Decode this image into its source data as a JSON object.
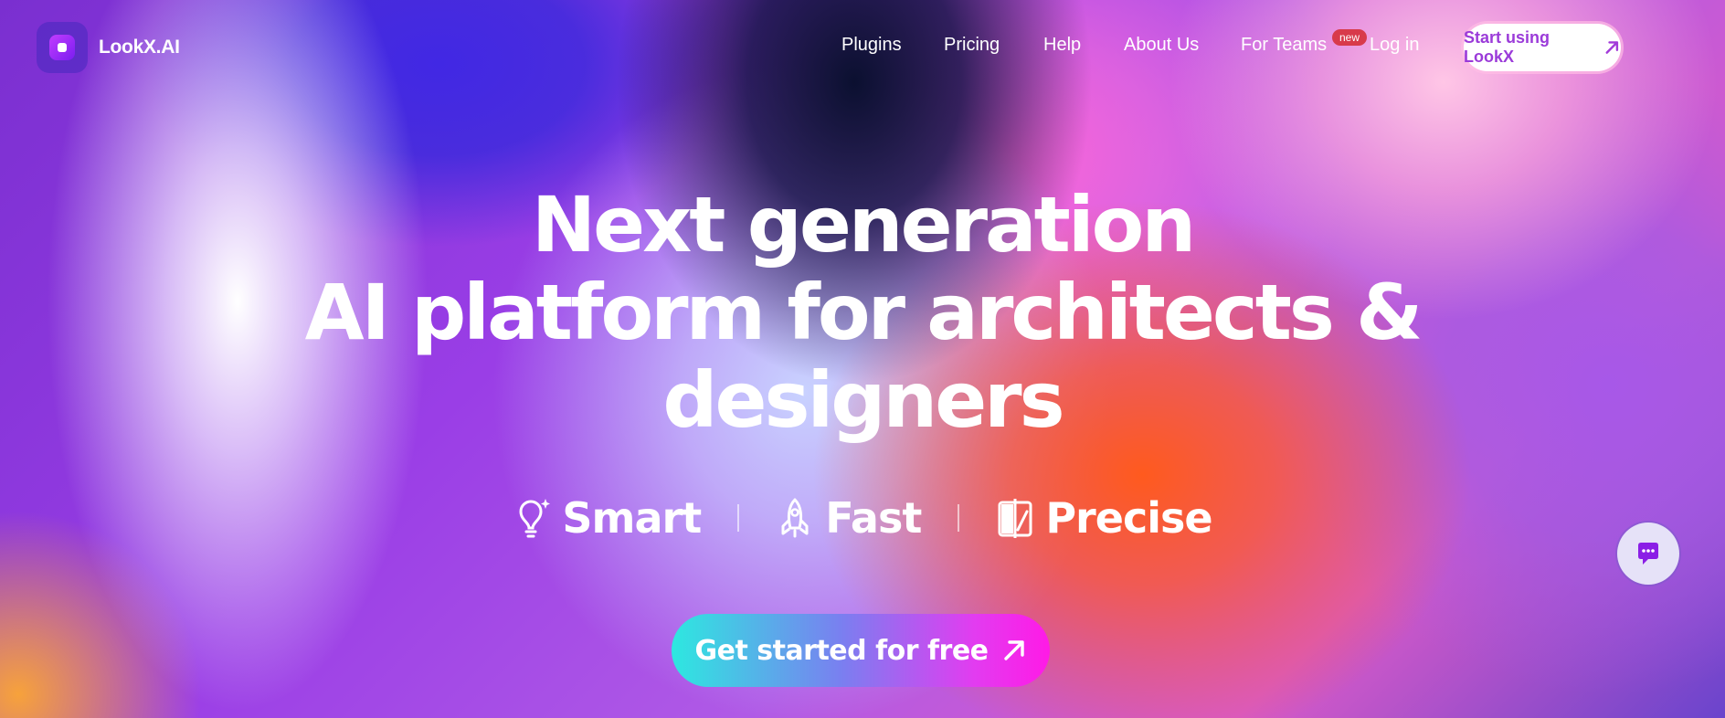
{
  "brand": {
    "name": "LookX.AI",
    "accent": "#8a2be2"
  },
  "nav": {
    "items": [
      "Plugins",
      "Pricing",
      "Help",
      "About Us",
      "For Teams"
    ],
    "badge": "new",
    "login": "Log in",
    "cta": "Start using LookX"
  },
  "hero": {
    "line1": "Next generation",
    "line2": "AI platform for architects &",
    "line3": "designers",
    "features": [
      {
        "label": "Smart",
        "icon": "lightbulb-icon"
      },
      {
        "label": "Fast",
        "icon": "rocket-icon"
      },
      {
        "label": "Precise",
        "icon": "compare-icon"
      }
    ],
    "cta": "Get started for free"
  },
  "chat": {
    "icon": "chat-icon"
  }
}
